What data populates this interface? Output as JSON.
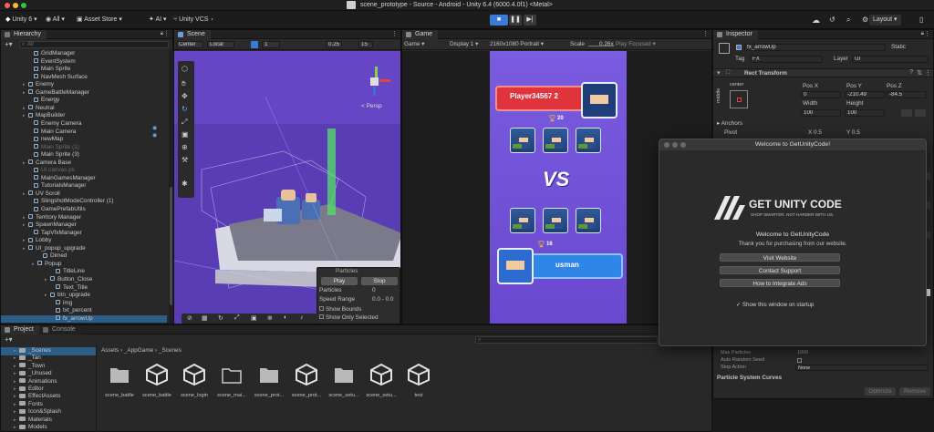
{
  "window": {
    "title": "scene_prototype - Source - Android - Unity 6.4 (6000.4.0f1) <Metal>"
  },
  "toolbar": {
    "app_name": "Unity 6",
    "all_label": "All",
    "asset_store_label": "Asset Store",
    "ai_label": "AI",
    "vcs_label": "Unity VCS",
    "layout_label": "Layout"
  },
  "hierarchy": {
    "tab": "Hierarchy",
    "search_placeholder": "All",
    "items": [
      {
        "label": "GridManager",
        "expand": false,
        "dim": false
      },
      {
        "label": "EventSystem",
        "expand": false,
        "dim": false
      },
      {
        "label": "Main Sprite",
        "expand": false,
        "dim": false
      },
      {
        "label": "NavMesh Surface",
        "expand": false,
        "dim": false
      },
      {
        "label": "Enemy",
        "expand": true,
        "dim": false
      },
      {
        "label": "GameBattleManager",
        "expand": true,
        "dim": false
      },
      {
        "label": "Energy",
        "expand": false,
        "dim": false
      },
      {
        "label": "Neutral",
        "expand": true,
        "dim": false
      },
      {
        "label": "MapBuilder",
        "expand": true,
        "dim": false
      },
      {
        "label": "Enemy Camera",
        "expand": false,
        "dim": false
      },
      {
        "label": "Main Camera",
        "expand": false,
        "dim": false
      },
      {
        "label": "newMap",
        "expand": false,
        "dim": false
      },
      {
        "label": "Main Sprite (1)",
        "expand": false,
        "dim": true
      },
      {
        "label": "Main Sprite (3)",
        "expand": false,
        "dim": false
      },
      {
        "label": "Camera Base",
        "expand": true,
        "dim": false
      },
      {
        "label": "UI.canvas.ps",
        "expand": false,
        "dim": true
      },
      {
        "label": "MainGamesManager",
        "expand": false,
        "dim": false
      },
      {
        "label": "TutorialsManager",
        "expand": false,
        "dim": false
      },
      {
        "label": "UV Scroll",
        "expand": true,
        "dim": false
      },
      {
        "label": "SlingshotModeController (1)",
        "expand": false,
        "dim": false
      },
      {
        "label": "GamePrefabUtils",
        "expand": false,
        "dim": false
      },
      {
        "label": "Territory Manager",
        "expand": true,
        "dim": false
      },
      {
        "label": "SpawnManager",
        "expand": true,
        "dim": false
      },
      {
        "label": "TapVfxManager",
        "expand": false,
        "dim": false
      },
      {
        "label": "Lobby",
        "expand": true,
        "dim": false
      },
      {
        "label": "UI_popup_upgrade",
        "expand": true,
        "dim": false
      },
      {
        "label": "Dimed",
        "expand": false,
        "dim": false
      },
      {
        "label": "Popup",
        "expand": true,
        "dim": false
      },
      {
        "label": "TitleLine",
        "expand": false,
        "dim": false
      },
      {
        "label": "Button_Close",
        "expand": true,
        "dim": false
      },
      {
        "label": "Text_Title",
        "expand": false,
        "dim": false
      },
      {
        "label": "btn_upgrade",
        "expand": true,
        "dim": false
      },
      {
        "label": "img",
        "expand": false,
        "dim": false
      },
      {
        "label": "txt_percent",
        "expand": false,
        "dim": false
      },
      {
        "label": "fx_arrowUp",
        "expand": false,
        "dim": false
      }
    ]
  },
  "scene": {
    "tab": "Scene",
    "pivot_label": "Center",
    "space_label": "Local",
    "snap_value": "0.25",
    "grid_value": "15",
    "layer_num": "1",
    "persp_label": "< Persp",
    "particles": {
      "title": "Particles",
      "play": "Play",
      "stop": "Stop",
      "rows": [
        {
          "label": "Particles",
          "value": "0"
        },
        {
          "label": "Speed Range",
          "value": "0.0 - 0.0"
        }
      ],
      "show_bounds": "Show Bounds",
      "show_only_selected": "Show Only Selected"
    }
  },
  "game": {
    "tab": "Game",
    "mode": "Game",
    "display": "Display 1",
    "resolution": "2160x1080 Portrait",
    "scale_label": "Scale",
    "scale_value": "0.26x",
    "play_focused": "Play Focused",
    "player1": "Player34567 2",
    "player1_trophies": "20",
    "vs": "VS",
    "player2": "usman",
    "player2_trophies": "16"
  },
  "inspector": {
    "tab": "Inspector",
    "object_name": "fx_arrowUp",
    "static_label": "Static",
    "tag_label": "Tag",
    "tag_value": "FX",
    "layer_label": "Layer",
    "layer_value": "UI",
    "rect_transform": "Rect Transform",
    "anchor_label": "center",
    "side_label": "middle",
    "pos_x_label": "Pos X",
    "pos_y_label": "Pos Y",
    "pos_z_label": "Pos Z",
    "pos_x": "0",
    "pos_y": "-210.49",
    "pos_z": "-84.5",
    "width_label": "Width",
    "height_label": "Height",
    "width": "100",
    "height": "100",
    "anchors_label": "Anchors",
    "pivot_label": "Pivot",
    "pivot_x": "X  0.5",
    "pivot_y": "Y  0.5",
    "rows": [
      {
        "label": "Max Particles",
        "value": "1000"
      },
      {
        "label": "Auto Random Seed",
        "value": ""
      },
      {
        "label": "Stop Action",
        "value": "None"
      }
    ],
    "curves_label": "Particle System Curves",
    "optimize_label": "Optimize",
    "remove_label": "Remove"
  },
  "project": {
    "tabs": [
      "Project",
      "Console"
    ],
    "breadcrumb": [
      "Assets",
      "_AppGame",
      "_Scenes"
    ],
    "folders": [
      "_Scenes",
      "_Tan",
      "_Town",
      "_Unused",
      "Animations",
      "Editor",
      "EffectAssets",
      "Fonts",
      "Icon&Splash",
      "Materials",
      "Models"
    ],
    "assets": [
      {
        "label": "scene_battle",
        "kind": "folder"
      },
      {
        "label": "scene_battle",
        "kind": "unity"
      },
      {
        "label": "scene_login",
        "kind": "unity"
      },
      {
        "label": "scene_mai...",
        "kind": "folder-outline"
      },
      {
        "label": "scene_prot...",
        "kind": "folder"
      },
      {
        "label": "scene_prot...",
        "kind": "unity"
      },
      {
        "label": "scene_setu...",
        "kind": "folder"
      },
      {
        "label": "scene_setu...",
        "kind": "unity"
      },
      {
        "label": "test",
        "kind": "unity"
      }
    ]
  },
  "welcome": {
    "title": "Welcome to GetUnityCode!",
    "brand": "GET UNITY CODE",
    "tagline": "SHOP SMARTER. NOT HARDER WITH US.",
    "heading": "Welcome to GetUnityCode",
    "subtext": "Thank you for purchasing from our website.",
    "btn_visit": "Visit Website",
    "btn_support": "Contact Support",
    "btn_ads": "How to Integrate Ads",
    "show_startup": "Show this window on startup"
  },
  "colors": {
    "accent": "#3a79d6",
    "game_bg": "#7b55d6",
    "scene_bg": "#5c3cb8",
    "banner_red": "#e0343c",
    "banner_blue": "#2f86e6"
  }
}
